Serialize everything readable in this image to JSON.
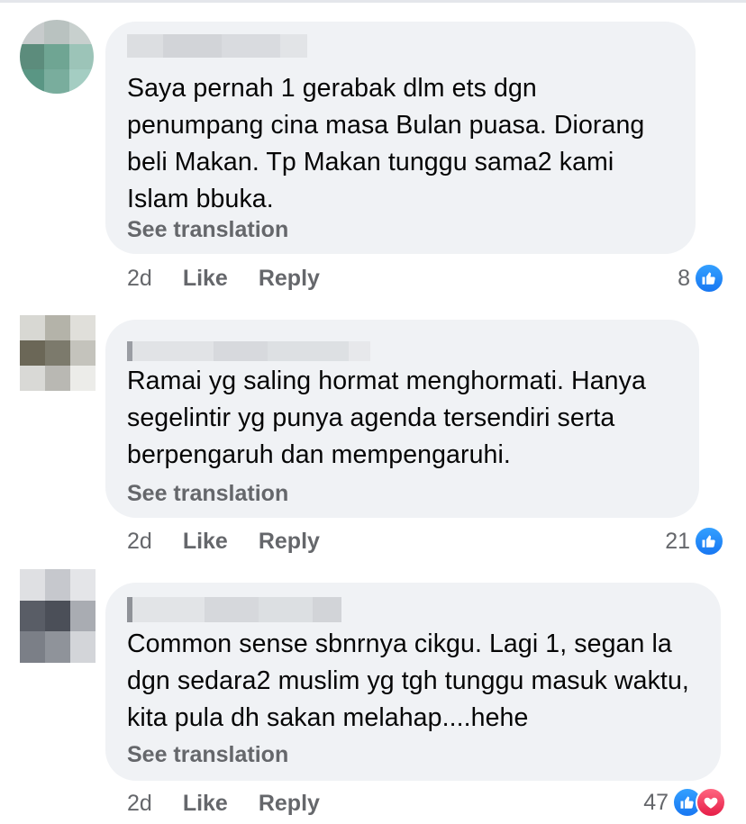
{
  "colors": {
    "bubble_bg": "#f0f2f5",
    "meta_text": "#65676b",
    "like_blue": "#1877f2",
    "love_red": "#f33e58"
  },
  "comments": [
    {
      "text": "Saya pernah 1 gerabak dlm ets dgn penumpang cina masa Bulan puasa. Diorang beli Makan. Tp Makan tunggu sama2 kami Islam bbuka.",
      "translate_label": "See translation",
      "time": "2d",
      "like_label": "Like",
      "reply_label": "Reply",
      "reaction_count": "8",
      "reactions": [
        "like-icon"
      ]
    },
    {
      "text": "Ramai yg saling hormat menghormati. Hanya segelintir yg punya agenda tersendiri serta berpengaruh dan mempengaruhi.",
      "translate_label": "See translation",
      "time": "2d",
      "like_label": "Like",
      "reply_label": "Reply",
      "reaction_count": "21",
      "reactions": [
        "like-icon"
      ]
    },
    {
      "text": "Common sense sbnrnya cikgu. Lagi 1, segan la dgn sedara2 muslim yg tgh tunggu masuk waktu, kita pula dh sakan melahap....hehe",
      "translate_label": "See translation",
      "time": "2d",
      "like_label": "Like",
      "reply_label": "Reply",
      "reaction_count": "47",
      "reactions": [
        "like-icon",
        "love-icon"
      ]
    }
  ]
}
